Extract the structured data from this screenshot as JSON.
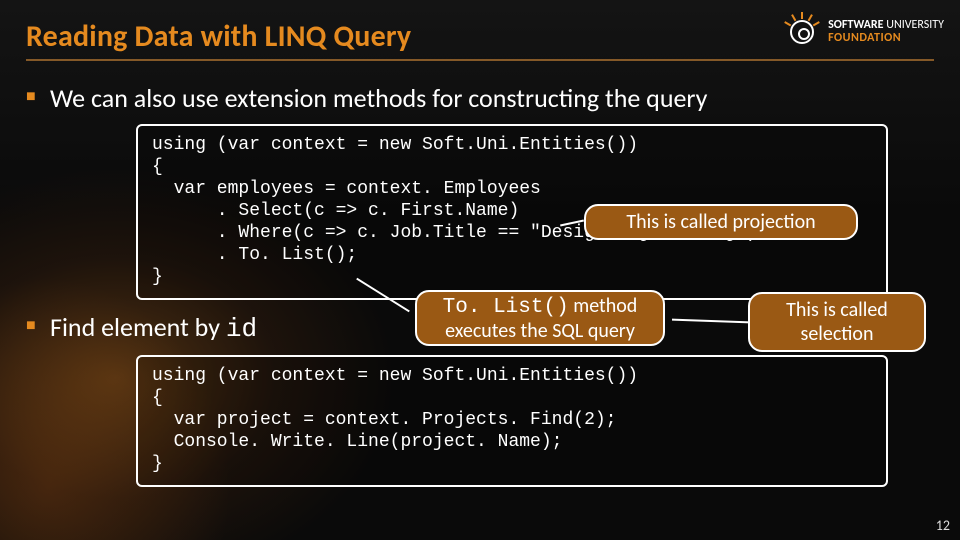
{
  "title": "Reading Data with LINQ Query",
  "bullet1": "We can also use extension methods for constructing the query",
  "bullet2_pre": "Find element by ",
  "bullet2_kw": "id",
  "code1": "using (var context = new Soft.Uni.Entities())\n{\n  var employees = context. Employees\n      . Select(c => c. First.Name)\n      . Where(c => c. Job.Title == \"Design Engineering\")\n      . To. List();\n}",
  "code2": "using (var context = new Soft.Uni.Entities())\n{\n  var project = context. Projects. Find(2);\n  Console. Write. Line(project. Name);\n}",
  "callouts": {
    "projection": "This is called projection",
    "tolist_l1_code": "To. List()",
    "tolist_l1_rest": " method",
    "tolist_l2": "executes the SQL query",
    "selection_l1": "This is called",
    "selection_l2": "selection"
  },
  "logo": {
    "l1a": "SOFTWARE",
    "l1b": " UNIVERSITY",
    "l2": "FOUNDATION"
  },
  "page": "12"
}
